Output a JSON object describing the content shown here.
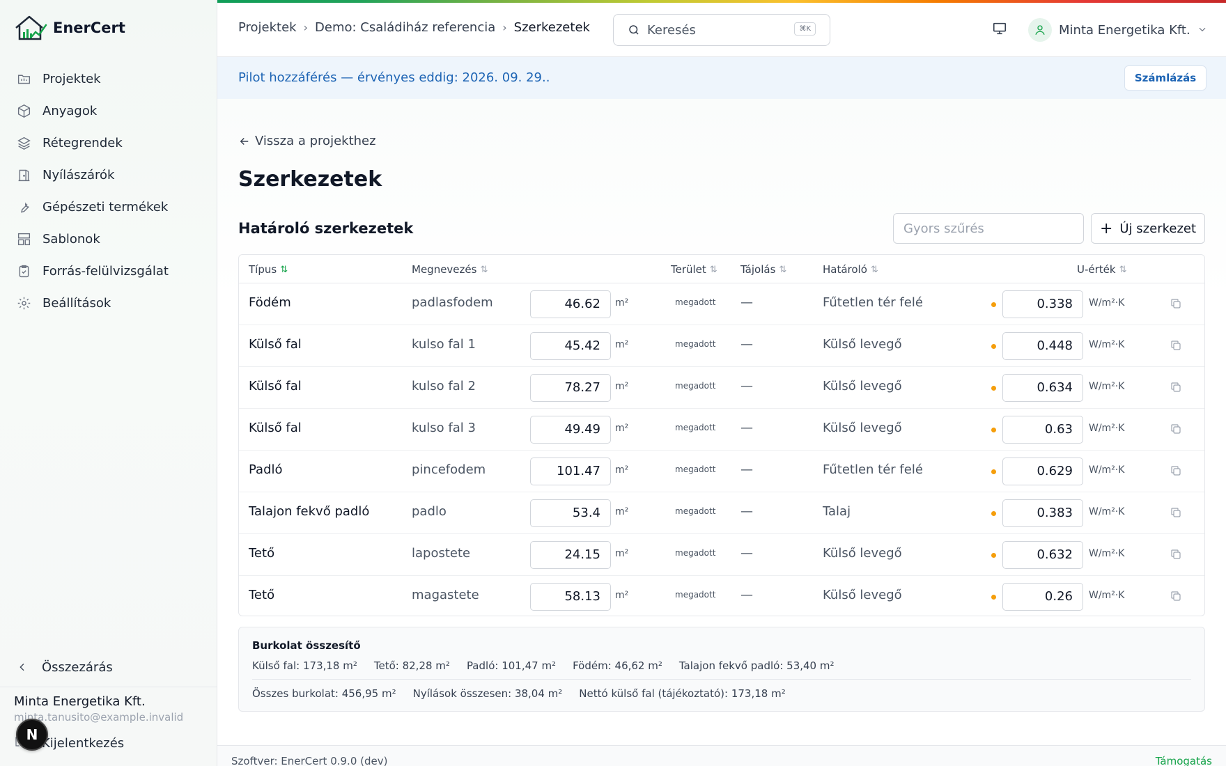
{
  "app": {
    "name": "EnerCert"
  },
  "sidebar": {
    "items": [
      {
        "label": "Projektek",
        "icon": "folder-icon"
      },
      {
        "label": "Anyagok",
        "icon": "box-icon"
      },
      {
        "label": "Rétegrendek",
        "icon": "layers-icon"
      },
      {
        "label": "Nyílászárók",
        "icon": "door-icon"
      },
      {
        "label": "Gépészeti termékek",
        "icon": "wrench-icon"
      },
      {
        "label": "Sablonok",
        "icon": "template-icon"
      },
      {
        "label": "Forrás-felülvizsgálat",
        "icon": "clipboard-check-icon"
      },
      {
        "label": "Beállítások",
        "icon": "gear-icon"
      }
    ],
    "collapse_label": "Összezárás",
    "account_name": "Minta Energetika Kft.",
    "account_email": "minta.tanusito@example.invalid",
    "logout_label": "Kijelentkezés",
    "fab_letter": "N"
  },
  "header": {
    "breadcrumbs": [
      "Projektek",
      "Demo: Családiház referencia",
      "Szerkezetek"
    ],
    "search_placeholder": "Keresés",
    "search_shortcut": "⌘K",
    "user_name": "Minta Energetika Kft."
  },
  "banner": {
    "text": "Pilot hozzáférés — érvényes eddig: 2026. 09. 29..",
    "button": "Számlázás"
  },
  "page": {
    "back_label": "Vissza a projekthez",
    "title": "Szerkezetek",
    "section_title": "Határoló szerkezetek",
    "filter_placeholder": "Gyors szűrés",
    "new_button": "Új szerkezet"
  },
  "table": {
    "headers": {
      "type": "Típus",
      "name": "Megnevezés",
      "area": "Terület",
      "orientation": "Tájolás",
      "boundary": "Határoló",
      "u_value": "U-érték"
    },
    "area_unit": "m²",
    "u_unit": "W/m²·K",
    "rows": [
      {
        "type": "Födém",
        "name": "padlasfodem",
        "area": "46.62",
        "source": "megadott",
        "orientation": "—",
        "boundary": "Fűtetlen tér felé",
        "u": "0.338"
      },
      {
        "type": "Külső fal",
        "name": "kulso fal 1",
        "area": "45.42",
        "source": "megadott",
        "orientation": "—",
        "boundary": "Külső levegő",
        "u": "0.448"
      },
      {
        "type": "Külső fal",
        "name": "kulso fal 2",
        "area": "78.27",
        "source": "megadott",
        "orientation": "—",
        "boundary": "Külső levegő",
        "u": "0.634"
      },
      {
        "type": "Külső fal",
        "name": "kulso fal 3",
        "area": "49.49",
        "source": "megadott",
        "orientation": "—",
        "boundary": "Külső levegő",
        "u": "0.63"
      },
      {
        "type": "Padló",
        "name": "pincefodem",
        "area": "101.47",
        "source": "megadott",
        "orientation": "—",
        "boundary": "Fűtetlen tér felé",
        "u": "0.629"
      },
      {
        "type": "Talajon fekvő padló",
        "name": "padlo",
        "area": "53.4",
        "source": "megadott",
        "orientation": "—",
        "boundary": "Talaj",
        "u": "0.383"
      },
      {
        "type": "Tető",
        "name": "lapostete",
        "area": "24.15",
        "source": "megadott",
        "orientation": "—",
        "boundary": "Külső levegő",
        "u": "0.632"
      },
      {
        "type": "Tető",
        "name": "magastete",
        "area": "58.13",
        "source": "megadott",
        "orientation": "—",
        "boundary": "Külső levegő",
        "u": "0.26"
      }
    ]
  },
  "summary": {
    "title": "Burkolat összesítő",
    "line1": [
      "Külső fal: 173,18 m²",
      "Tető: 82,28 m²",
      "Padló: 101,47 m²",
      "Födém: 46,62 m²",
      "Talajon fekvő padló: 53,40 m²"
    ],
    "line2": [
      "Összes burkolat: 456,95 m²",
      "Nyílások összesen: 38,04 m²",
      "Nettó külső fal (tájékoztató): 173,18 m²"
    ]
  },
  "footer": {
    "version": "Szoftver: EnerCert 0.9.0 (dev)",
    "support": "Támogatás"
  },
  "colors": {
    "accent": "#16a34a",
    "link": "#1d64b4",
    "status_dot": "#f59e0b"
  }
}
